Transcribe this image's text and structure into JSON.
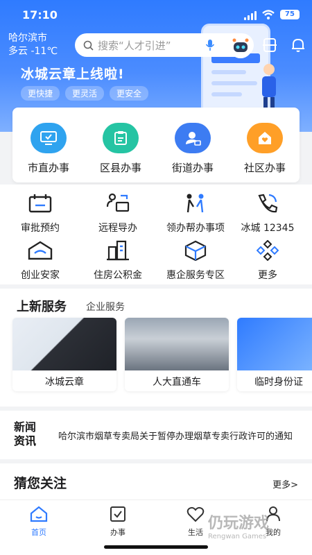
{
  "status": {
    "time": "17:10",
    "battery": "75"
  },
  "header": {
    "city": "哈尔滨市",
    "weather": "多云 -11℃",
    "search_placeholder": "搜索“人才引进”",
    "promo_title": "冰城云章上线啦!",
    "tags": [
      "更快捷",
      "更灵活",
      "更安全"
    ]
  },
  "main_services": [
    {
      "label": "市直办事",
      "icon": "monitor-icon",
      "color": "#2fa3ef"
    },
    {
      "label": "区县办事",
      "icon": "clipboard-icon",
      "color": "#25c4a3"
    },
    {
      "label": "街道办事",
      "icon": "person-id-icon",
      "color": "#3d7cf2"
    },
    {
      "label": "社区办事",
      "icon": "house-heart-icon",
      "color": "#ff9f27"
    }
  ],
  "grid": [
    {
      "label": "审批预约",
      "icon": "calendar-icon"
    },
    {
      "label": "远程导办",
      "icon": "remote-guide-icon"
    },
    {
      "label": "领办帮办事项",
      "icon": "people-help-icon"
    },
    {
      "label": "冰城 12345",
      "icon": "phone-icon"
    },
    {
      "label": "创业安家",
      "icon": "home-wifi-icon"
    },
    {
      "label": "住房公积金",
      "icon": "building-icon"
    },
    {
      "label": "惠企服务专区",
      "icon": "box-icon"
    },
    {
      "label": "更多",
      "icon": "diamonds-icon"
    }
  ],
  "new_services": {
    "title": "上新服务",
    "tab": "企业服务",
    "tiles": [
      "冰城云章",
      "人大直通车",
      "临时身份证"
    ]
  },
  "news": {
    "badge_line1": "新闻",
    "badge_line2": "资讯",
    "headline": "哈尔滨市烟草专卖局关于暂停办理烟草专卖行政许可的通知"
  },
  "follow": {
    "title": "猜您关注",
    "more": "更多>"
  },
  "tabbar": [
    {
      "label": "首页",
      "icon": "home-icon",
      "active": true
    },
    {
      "label": "办事",
      "icon": "checkbox-icon",
      "active": false
    },
    {
      "label": "生活",
      "icon": "heart-icon",
      "active": false
    },
    {
      "label": "我的",
      "icon": "user-icon",
      "active": false
    }
  ],
  "watermark": {
    "name": "仍玩游戏",
    "sub": "Rengwan Games"
  }
}
